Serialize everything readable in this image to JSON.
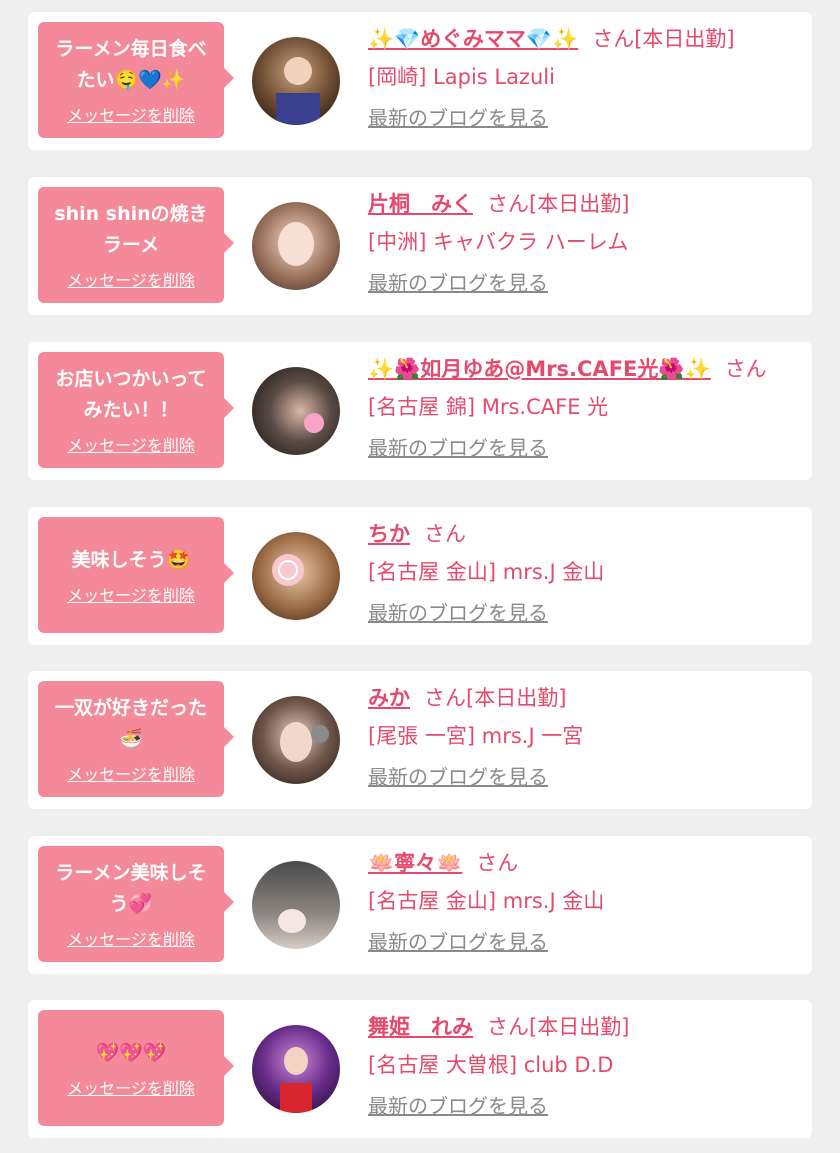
{
  "delete_label": "メッセージを削除",
  "blog_label": "最新のブログを見る",
  "colors": {
    "accent": "#e54a6d",
    "bubble": "#f48a99",
    "link_gray": "#8a8a8a",
    "background": "#efefef"
  },
  "messages": [
    {
      "text": "ラーメン毎日食べたい🤤💙✨",
      "name": "✨💎めぐみママ💎✨",
      "suffix": "さん[本日出勤]",
      "shop": "[岡崎] Lapis Lazuli"
    },
    {
      "text": "shin shinの焼きラーメ",
      "name": "片桐　みく",
      "suffix": "さん[本日出勤]",
      "shop": "[中洲] キャバクラ ハーレム"
    },
    {
      "text": "お店いつかいってみたい！！",
      "name": "✨🌺如月ゆあ@Mrs.CAFE光🌺✨",
      "suffix": "さん",
      "shop": "[名古屋 錦] Mrs.CAFE 光"
    },
    {
      "text": "美味しそう🤩",
      "name": "ちか",
      "suffix": "さん",
      "shop": "[名古屋 金山] mrs.J 金山"
    },
    {
      "text": "一双が好きだった🍜",
      "name": "みか",
      "suffix": "さん[本日出勤]",
      "shop": "[尾張 一宮] mrs.J 一宮"
    },
    {
      "text": "ラーメン美味しそう💞",
      "name": "🪷寧々🪷",
      "suffix": "さん",
      "shop": "[名古屋 金山] mrs.J 金山"
    },
    {
      "text": "💖💖💖",
      "name": "舞姫　れみ",
      "suffix": "さん[本日出勤]",
      "shop": "[名古屋 大曽根] club D.D"
    }
  ]
}
